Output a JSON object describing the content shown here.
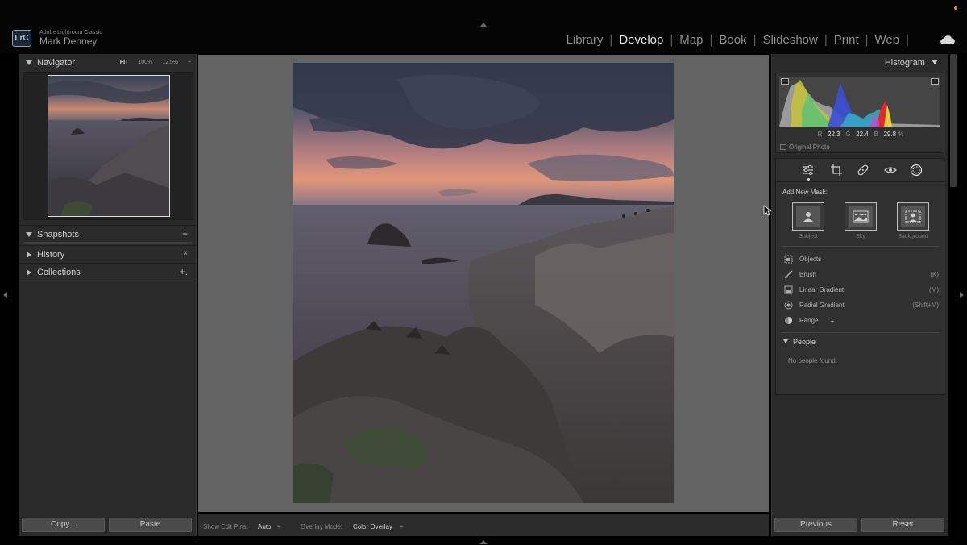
{
  "app": {
    "logo": "LrC",
    "name": "Adobe Lightroom Classic",
    "user": "Mark Denney"
  },
  "modules": [
    {
      "label": "Library",
      "active": false
    },
    {
      "label": "Develop",
      "active": true
    },
    {
      "label": "Map",
      "active": false
    },
    {
      "label": "Book",
      "active": false
    },
    {
      "label": "Slideshow",
      "active": false
    },
    {
      "label": "Print",
      "active": false
    },
    {
      "label": "Web",
      "active": false
    }
  ],
  "left": {
    "navigator": {
      "title": "Navigator",
      "zoom_fit": "FIT",
      "zoom_100": "100%",
      "zoom_custom": "12.5%"
    },
    "snapshots": {
      "title": "Snapshots",
      "action": "+"
    },
    "history": {
      "title": "History",
      "action": "×"
    },
    "collections": {
      "title": "Collections",
      "action": "+."
    },
    "copy_button": "Copy...",
    "paste_button": "Paste"
  },
  "toolbar": {
    "show_edit_pins_label": "Show Edit Pins:",
    "show_edit_pins_value": "Auto",
    "overlay_mode_label": "Overlay Mode:",
    "overlay_mode_value": "Color Overlay",
    "spinner": "÷"
  },
  "right": {
    "histogram": {
      "title": "Histogram",
      "r_label": "R",
      "r_value": "22.3",
      "g_label": "G",
      "g_value": "22.4",
      "b_label": "B",
      "b_value": "29.8",
      "unit": "%",
      "original_photo": "Original Photo"
    },
    "masking": {
      "add_new_mask": "Add New Mask:",
      "buttons": [
        {
          "label": "Subject"
        },
        {
          "label": "Sky"
        },
        {
          "label": "Background"
        }
      ],
      "items": [
        {
          "label": "Objects",
          "shortcut": ""
        },
        {
          "label": "Brush",
          "shortcut": "(K)"
        },
        {
          "label": "Linear Gradient",
          "shortcut": "(M)"
        },
        {
          "label": "Radial Gradient",
          "shortcut": "(Shift+M)"
        },
        {
          "label": "Range",
          "shortcut": ""
        }
      ],
      "people_title": "People",
      "no_people": "No people found."
    },
    "previous_button": "Previous",
    "reset_button": "Reset"
  }
}
